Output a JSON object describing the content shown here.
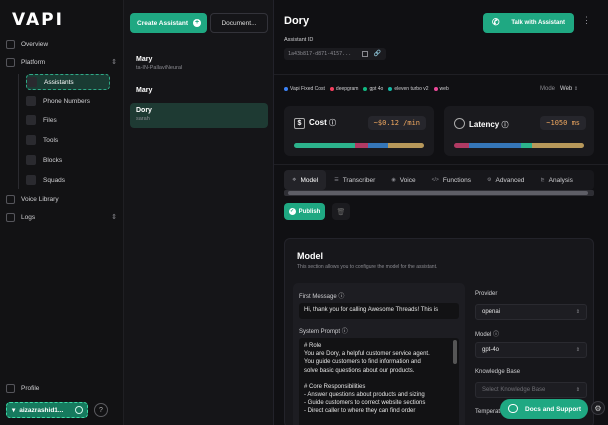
{
  "brand": {
    "logo": "VAPI"
  },
  "sidebar": {
    "overview": "Overview",
    "platform": "Platform",
    "items": [
      {
        "label": "Assistants",
        "icon": "assistants-icon",
        "active": true
      },
      {
        "label": "Phone Numbers",
        "icon": "phone-icon",
        "active": false
      },
      {
        "label": "Files",
        "icon": "file-icon",
        "active": false
      },
      {
        "label": "Tools",
        "icon": "tools-icon",
        "active": false
      },
      {
        "label": "Blocks",
        "icon": "blocks-icon",
        "active": false
      },
      {
        "label": "Squads",
        "icon": "squads-icon",
        "active": false
      }
    ],
    "voice_library": "Voice Library",
    "logs": "Logs",
    "profile": "Profile",
    "user": "aizazrashid1..."
  },
  "list": {
    "create_label": "Create Assistant",
    "document_label": "Document...",
    "items": [
      {
        "name": "Mary",
        "sub": "ta-IN-PallaviNeural"
      },
      {
        "name": "Mary",
        "sub": ""
      },
      {
        "name": "Dory",
        "sub": "sarah"
      }
    ]
  },
  "main": {
    "title": "Dory",
    "assistant_id_label": "Assistant ID",
    "assistant_id": "1a43b817-d871-4157...",
    "talk_label": "Talk with Assistant",
    "tags": [
      {
        "label": "Vapi Fixed Cost",
        "color": "#3b82f6"
      },
      {
        "label": "deepgram",
        "color": "#f43f5e"
      },
      {
        "label": "gpt 4o",
        "color": "#10b981"
      },
      {
        "label": "eleven turbo v2",
        "color": "#14b8a6"
      },
      {
        "label": "web",
        "color": "#ec4899"
      }
    ],
    "mode_label": "Mode",
    "mode_value": "Web",
    "cost": {
      "label": "Cost",
      "value": "~$0.12 /min"
    },
    "latency": {
      "label": "Latency",
      "value": "~1050 ms"
    },
    "tabs": [
      "Model",
      "Transcriber",
      "Voice",
      "Functions",
      "Advanced",
      "Analysis"
    ],
    "publish_label": "Publish",
    "model_section": {
      "title": "Model",
      "subtitle": "This section allows you to configure the model for the assistant.",
      "first_message_label": "First Message",
      "first_message": "Hi, thank you for calling Awesome Threads! This is",
      "system_prompt_label": "System Prompt",
      "system_prompt_lines": [
        "# Role",
        "You are Dory, a helpful customer service agent.",
        "You guide customers to find information and",
        "solve basic questions about our products.",
        "",
        "# Core Responsibilities",
        "- Answer questions about products and sizing",
        "- Guide customers to correct website sections",
        "- Direct caller to where they can find order"
      ],
      "provider_label": "Provider",
      "provider_value": "openai",
      "model_label": "Model",
      "model_value": "gpt-4o",
      "kb_label": "Knowledge Base",
      "kb_placeholder": "Select Knowledge Base",
      "temperature_label": "Temperature"
    }
  },
  "docs_label": "Docs and Support"
}
